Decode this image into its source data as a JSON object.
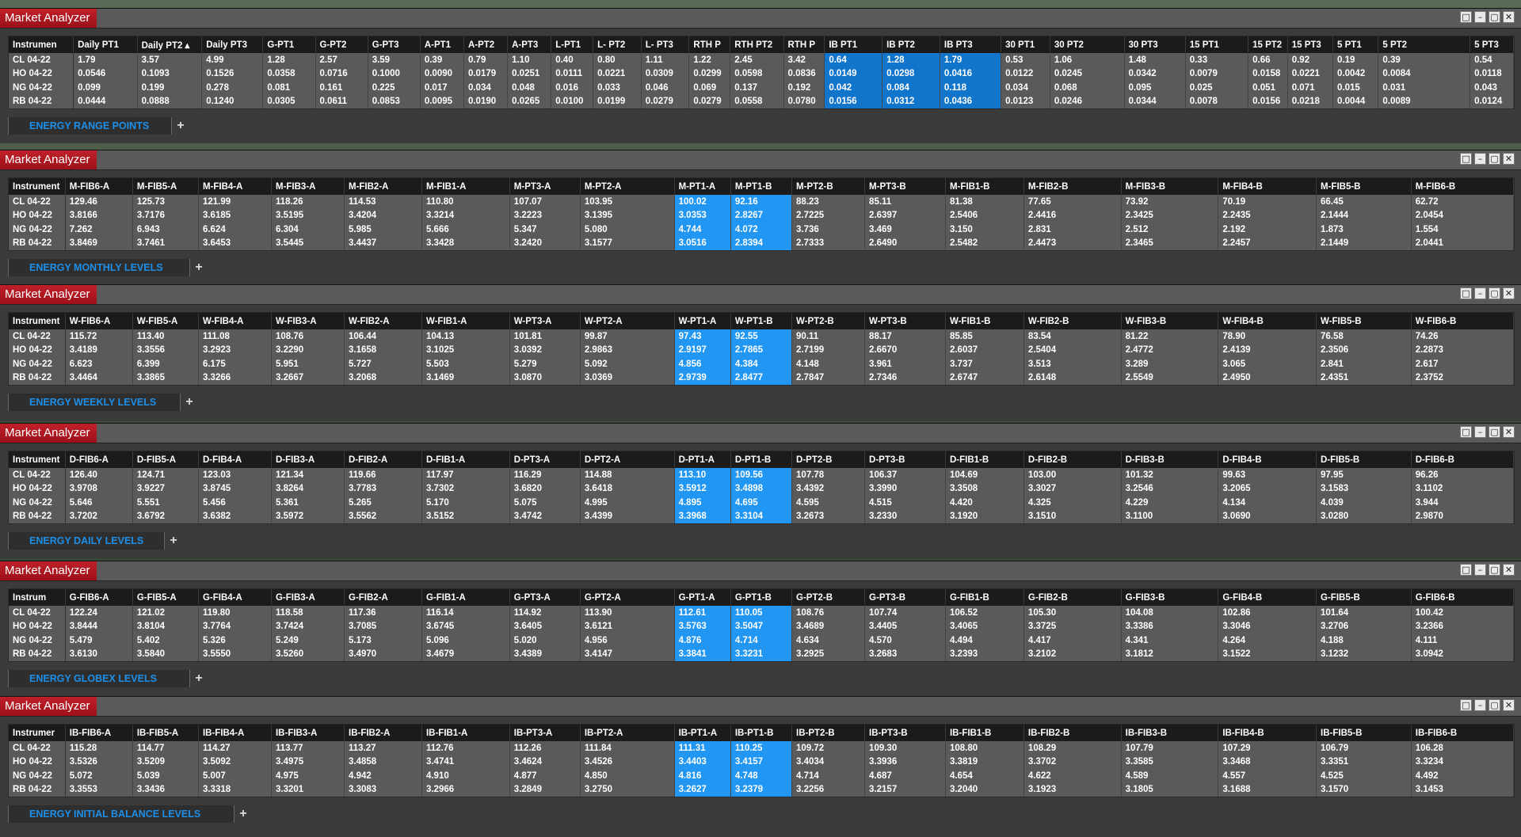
{
  "window_title": "Market Analyzer",
  "window_buttons": [
    "□",
    "–",
    "▢",
    "✕"
  ],
  "panels": [
    {
      "title": "Market Analyzer",
      "tab": "ENERGY RANGE POINTS",
      "headers": [
        "Instrumen",
        "Daily PT1",
        "Daily PT2 ▴",
        "Daily PT3",
        "G-PT1",
        "G-PT2",
        "G-PT3",
        "A-PT1",
        "A-PT2",
        "A-PT3",
        "L-PT1",
        "L- PT2",
        "L- PT3",
        "RTH P",
        "RTH PT2",
        "RTH P",
        "IB PT1",
        "IB PT2",
        "IB PT3",
        "30 PT1",
        "30 PT2",
        "30 PT3",
        "15 PT1",
        "15 PT2",
        "15 PT3",
        "5 PT1",
        "5 PT2",
        "5 PT3"
      ],
      "widths": [
        74,
        73,
        74,
        70,
        60,
        60,
        60,
        50,
        50,
        50,
        48,
        55,
        55,
        47,
        61,
        47,
        66,
        66,
        70,
        56,
        85,
        70,
        72,
        45,
        52,
        52,
        105,
        50
      ],
      "highlight": [
        16,
        17,
        18
      ],
      "rows": [
        [
          "CL 04-22",
          "1.79",
          "3.57",
          "4.99",
          "1.28",
          "2.57",
          "3.59",
          "0.39",
          "0.79",
          "1.10",
          "0.40",
          "0.80",
          "1.11",
          "1.22",
          "2.45",
          "3.42",
          "0.64",
          "1.28",
          "1.79",
          "0.53",
          "1.06",
          "1.48",
          "0.33",
          "0.66",
          "0.92",
          "0.19",
          "0.39",
          "0.54"
        ],
        [
          "HO 04-22",
          "0.0546",
          "0.1093",
          "0.1526",
          "0.0358",
          "0.0716",
          "0.1000",
          "0.0090",
          "0.0179",
          "0.0251",
          "0.0111",
          "0.0221",
          "0.0309",
          "0.0299",
          "0.0598",
          "0.0836",
          "0.0149",
          "0.0298",
          "0.0416",
          "0.0122",
          "0.0245",
          "0.0342",
          "0.0079",
          "0.0158",
          "0.0221",
          "0.0042",
          "0.0084",
          "0.0118"
        ],
        [
          "NG 04-22",
          "0.099",
          "0.199",
          "0.278",
          "0.081",
          "0.161",
          "0.225",
          "0.017",
          "0.034",
          "0.048",
          "0.016",
          "0.033",
          "0.046",
          "0.069",
          "0.137",
          "0.192",
          "0.042",
          "0.084",
          "0.118",
          "0.034",
          "0.068",
          "0.095",
          "0.025",
          "0.051",
          "0.071",
          "0.015",
          "0.031",
          "0.043"
        ],
        [
          "RB 04-22",
          "0.0444",
          "0.0888",
          "0.1240",
          "0.0305",
          "0.0611",
          "0.0853",
          "0.0095",
          "0.0190",
          "0.0265",
          "0.0100",
          "0.0199",
          "0.0279",
          "0.0279",
          "0.0558",
          "0.0780",
          "0.0156",
          "0.0312",
          "0.0436",
          "0.0123",
          "0.0246",
          "0.0344",
          "0.0078",
          "0.0156",
          "0.0218",
          "0.0044",
          "0.0089",
          "0.0124"
        ]
      ]
    },
    {
      "title": "Market Analyzer",
      "tab": "ENERGY MONTHLY LEVELS",
      "headers": [
        "Instrument",
        "M-FIB6-A",
        "M-FIB5-A",
        "M-FIB4-A",
        "M-FIB3-A",
        "M-FIB2-A",
        "M-FIB1-A",
        "M-PT3-A",
        "M-PT2-A",
        "M-PT1-A",
        "M-PT1-B",
        "M-PT2-B",
        "M-PT3-B",
        "M-FIB1-B",
        "M-FIB2-B",
        "M-FIB3-B",
        "M-FIB4-B",
        "M-FIB5-B",
        "M-FIB6-B"
      ],
      "widths": [
        72,
        86,
        84,
        93,
        93,
        99,
        112,
        90,
        120,
        72,
        78,
        93,
        103,
        100,
        124,
        124,
        125,
        121,
        131
      ],
      "highlight": [
        9,
        10
      ],
      "rows": [
        [
          "CL 04-22",
          "129.46",
          "125.73",
          "121.99",
          "118.26",
          "114.53",
          "110.80",
          "107.07",
          "103.95",
          "100.02",
          "92.16",
          "88.23",
          "85.11",
          "81.38",
          "77.65",
          "73.92",
          "70.19",
          "66.45",
          "62.72"
        ],
        [
          "HO 04-22",
          "3.8166",
          "3.7176",
          "3.6185",
          "3.5195",
          "3.4204",
          "3.3214",
          "3.2223",
          "3.1395",
          "3.0353",
          "2.8267",
          "2.7225",
          "2.6397",
          "2.5406",
          "2.4416",
          "2.3425",
          "2.2435",
          "2.1444",
          "2.0454"
        ],
        [
          "NG 04-22",
          "7.262",
          "6.943",
          "6.624",
          "6.304",
          "5.985",
          "5.666",
          "5.347",
          "5.080",
          "4.744",
          "4.072",
          "3.736",
          "3.469",
          "3.150",
          "2.831",
          "2.512",
          "2.192",
          "1.873",
          "1.554"
        ],
        [
          "RB 04-22",
          "3.8469",
          "3.7461",
          "3.6453",
          "3.5445",
          "3.4437",
          "3.3428",
          "3.2420",
          "3.1577",
          "3.0516",
          "2.8394",
          "2.7333",
          "2.6490",
          "2.5482",
          "2.4473",
          "2.3465",
          "2.2457",
          "2.1449",
          "2.0441"
        ]
      ]
    },
    {
      "title": "Market Analyzer",
      "tab": "ENERGY WEEKLY LEVELS",
      "headers": [
        "Instrument",
        "W-FIB6-A",
        "W-FIB5-A",
        "W-FIB4-A",
        "W-FIB3-A",
        "W-FIB2-A",
        "W-FIB1-A",
        "W-PT3-A",
        "W-PT2-A",
        "W-PT1-A",
        "W-PT1-B",
        "W-PT2-B",
        "W-PT3-B",
        "W-FIB1-B",
        "W-FIB2-B",
        "W-FIB3-B",
        "W-FIB4-B",
        "W-FIB5-B",
        "W-FIB6-B"
      ],
      "widths": [
        72,
        86,
        84,
        93,
        93,
        99,
        112,
        90,
        120,
        72,
        78,
        93,
        103,
        100,
        124,
        124,
        125,
        121,
        131
      ],
      "highlight": [
        9,
        10
      ],
      "rows": [
        [
          "CL 04-22",
          "115.72",
          "113.40",
          "111.08",
          "108.76",
          "106.44",
          "104.13",
          "101.81",
          "99.87",
          "97.43",
          "92.55",
          "90.11",
          "88.17",
          "85.85",
          "83.54",
          "81.22",
          "78.90",
          "76.58",
          "74.26"
        ],
        [
          "HO 04-22",
          "3.4189",
          "3.3556",
          "3.2923",
          "3.2290",
          "3.1658",
          "3.1025",
          "3.0392",
          "2.9863",
          "2.9197",
          "2.7865",
          "2.7199",
          "2.6670",
          "2.6037",
          "2.5404",
          "2.4772",
          "2.4139",
          "2.3506",
          "2.2873"
        ],
        [
          "NG 04-22",
          "6.623",
          "6.399",
          "6.175",
          "5.951",
          "5.727",
          "5.503",
          "5.279",
          "5.092",
          "4.856",
          "4.384",
          "4.148",
          "3.961",
          "3.737",
          "3.513",
          "3.289",
          "3.065",
          "2.841",
          "2.617"
        ],
        [
          "RB 04-22",
          "3.4464",
          "3.3865",
          "3.3266",
          "3.2667",
          "3.2068",
          "3.1469",
          "3.0870",
          "3.0369",
          "2.9739",
          "2.8477",
          "2.7847",
          "2.7346",
          "2.6747",
          "2.6148",
          "2.5549",
          "2.4950",
          "2.4351",
          "2.3752"
        ]
      ]
    },
    {
      "title": "Market Analyzer",
      "tab": "ENERGY DAILY LEVELS",
      "headers": [
        "Instrument",
        "D-FIB6-A",
        "D-FIB5-A",
        "D-FIB4-A",
        "D-FIB3-A",
        "D-FIB2-A",
        "D-FIB1-A",
        "D-PT3-A",
        "D-PT2-A",
        "D-PT1-A",
        "D-PT1-B",
        "D-PT2-B",
        "D-PT3-B",
        "D-FIB1-B",
        "D-FIB2-B",
        "D-FIB3-B",
        "D-FIB4-B",
        "D-FIB5-B",
        "D-FIB6-B"
      ],
      "widths": [
        72,
        86,
        84,
        93,
        93,
        99,
        112,
        90,
        120,
        72,
        78,
        93,
        103,
        100,
        124,
        124,
        125,
        121,
        131
      ],
      "highlight": [
        9,
        10
      ],
      "rows": [
        [
          "CL 04-22",
          "126.40",
          "124.71",
          "123.03",
          "121.34",
          "119.66",
          "117.97",
          "116.29",
          "114.88",
          "113.10",
          "109.56",
          "107.78",
          "106.37",
          "104.69",
          "103.00",
          "101.32",
          "99.63",
          "97.95",
          "96.26"
        ],
        [
          "HO 04-22",
          "3.9708",
          "3.9227",
          "3.8745",
          "3.8264",
          "3.7783",
          "3.7302",
          "3.6820",
          "3.6418",
          "3.5912",
          "3.4898",
          "3.4392",
          "3.3990",
          "3.3508",
          "3.3027",
          "3.2546",
          "3.2065",
          "3.1583",
          "3.1102"
        ],
        [
          "NG 04-22",
          "5.646",
          "5.551",
          "5.456",
          "5.361",
          "5.265",
          "5.170",
          "5.075",
          "4.995",
          "4.895",
          "4.695",
          "4.595",
          "4.515",
          "4.420",
          "4.325",
          "4.229",
          "4.134",
          "4.039",
          "3.944"
        ],
        [
          "RB 04-22",
          "3.7202",
          "3.6792",
          "3.6382",
          "3.5972",
          "3.5562",
          "3.5152",
          "3.4742",
          "3.4399",
          "3.3968",
          "3.3104",
          "3.2673",
          "3.2330",
          "3.1920",
          "3.1510",
          "3.1100",
          "3.0690",
          "3.0280",
          "2.9870"
        ]
      ]
    },
    {
      "title": "Market Analyzer",
      "tab": "ENERGY GLOBEX LEVELS",
      "headers": [
        "Instrum",
        "G-FIB6-A",
        "G-FIB5-A",
        "G-FIB4-A",
        "G-FIB3-A",
        "G-FIB2-A",
        "G-FIB1-A",
        "G-PT3-A",
        "G-PT2-A",
        "G-PT1-A",
        "G-PT1-B",
        "G-PT2-B",
        "G-PT3-B",
        "G-FIB1-B",
        "G-FIB2-B",
        "G-FIB3-B",
        "G-FIB4-B",
        "G-FIB5-B",
        "G-FIB6-B"
      ],
      "widths": [
        72,
        86,
        84,
        93,
        93,
        99,
        112,
        90,
        120,
        72,
        78,
        93,
        103,
        100,
        124,
        124,
        125,
        121,
        131
      ],
      "highlight": [
        9,
        10
      ],
      "rows": [
        [
          "CL 04-22",
          "122.24",
          "121.02",
          "119.80",
          "118.58",
          "117.36",
          "116.14",
          "114.92",
          "113.90",
          "112.61",
          "110.05",
          "108.76",
          "107.74",
          "106.52",
          "105.30",
          "104.08",
          "102.86",
          "101.64",
          "100.42"
        ],
        [
          "HO 04-22",
          "3.8444",
          "3.8104",
          "3.7764",
          "3.7424",
          "3.7085",
          "3.6745",
          "3.6405",
          "3.6121",
          "3.5763",
          "3.5047",
          "3.4689",
          "3.4405",
          "3.4065",
          "3.3725",
          "3.3386",
          "3.3046",
          "3.2706",
          "3.2366"
        ],
        [
          "NG 04-22",
          "5.479",
          "5.402",
          "5.326",
          "5.249",
          "5.173",
          "5.096",
          "5.020",
          "4.956",
          "4.876",
          "4.714",
          "4.634",
          "4.570",
          "4.494",
          "4.417",
          "4.341",
          "4.264",
          "4.188",
          "4.111"
        ],
        [
          "RB 04-22",
          "3.6130",
          "3.5840",
          "3.5550",
          "3.5260",
          "3.4970",
          "3.4679",
          "3.4389",
          "3.4147",
          "3.3841",
          "3.3231",
          "3.2925",
          "3.2683",
          "3.2393",
          "3.2102",
          "3.1812",
          "3.1522",
          "3.1232",
          "3.0942"
        ]
      ]
    },
    {
      "title": "Market Analyzer",
      "tab": "ENERGY INITIAL BALANCE LEVELS",
      "headers": [
        "Instrumer",
        "IB-FIB6-A",
        "IB-FIB5-A",
        "IB-FIB4-A",
        "IB-FIB3-A",
        "IB-FIB2-A",
        "IB-FIB1-A",
        "IB-PT3-A",
        "IB-PT2-A",
        "IB-PT1-A",
        "IB-PT1-B",
        "IB-PT2-B",
        "IB-PT3-B",
        "IB-FIB1-B",
        "IB-FIB2-B",
        "IB-FIB3-B",
        "IB-FIB4-B",
        "IB-FIB5-B",
        "IB-FIB6-B"
      ],
      "widths": [
        72,
        86,
        84,
        93,
        93,
        99,
        112,
        90,
        120,
        72,
        78,
        93,
        103,
        100,
        124,
        124,
        125,
        121,
        131
      ],
      "highlight": [
        9,
        10
      ],
      "rows": [
        [
          "CL 04-22",
          "115.28",
          "114.77",
          "114.27",
          "113.77",
          "113.27",
          "112.76",
          "112.26",
          "111.84",
          "111.31",
          "110.25",
          "109.72",
          "109.30",
          "108.80",
          "108.29",
          "107.79",
          "107.29",
          "106.79",
          "106.28"
        ],
        [
          "HO 04-22",
          "3.5326",
          "3.5209",
          "3.5092",
          "3.4975",
          "3.4858",
          "3.4741",
          "3.4624",
          "3.4526",
          "3.4403",
          "3.4157",
          "3.4034",
          "3.3936",
          "3.3819",
          "3.3702",
          "3.3585",
          "3.3468",
          "3.3351",
          "3.3234"
        ],
        [
          "NG 04-22",
          "5.072",
          "5.039",
          "5.007",
          "4.975",
          "4.942",
          "4.910",
          "4.877",
          "4.850",
          "4.816",
          "4.748",
          "4.714",
          "4.687",
          "4.654",
          "4.622",
          "4.589",
          "4.557",
          "4.525",
          "4.492"
        ],
        [
          "RB 04-22",
          "3.3553",
          "3.3436",
          "3.3318",
          "3.3201",
          "3.3083",
          "3.2966",
          "3.2849",
          "3.2750",
          "3.2627",
          "3.2379",
          "3.2256",
          "3.2157",
          "3.2040",
          "3.1923",
          "3.1805",
          "3.1688",
          "3.1570",
          "3.1453"
        ]
      ]
    }
  ]
}
